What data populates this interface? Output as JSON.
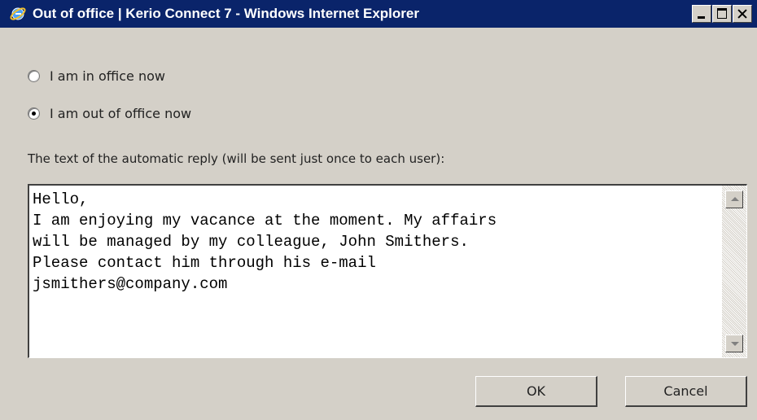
{
  "window": {
    "title": "Out of office | Kerio Connect 7 - Windows Internet Explorer",
    "icon": "internet-explorer-icon",
    "titlebar_color": "#0a246a"
  },
  "status": {
    "options": [
      {
        "label": "I am in office now",
        "selected": false
      },
      {
        "label": "I am out of office now",
        "selected": true
      }
    ]
  },
  "reply": {
    "label": "The text of the automatic reply (will be sent just once to each user):",
    "text": "Hello,\nI am enjoying my vacance at the moment. My affairs\nwill be managed by my colleague, John Smithers.\nPlease contact him through his e-mail\njsmithers@company.com"
  },
  "buttons": {
    "ok": "OK",
    "cancel": "Cancel"
  }
}
